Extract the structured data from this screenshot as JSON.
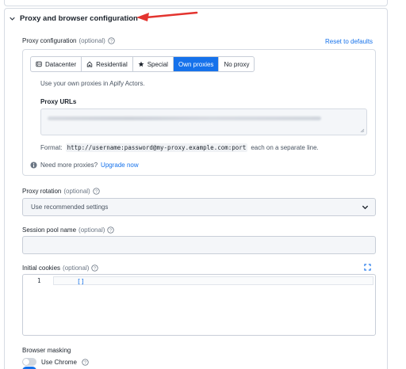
{
  "section": {
    "title": "Proxy and browser configuration"
  },
  "proxy_config": {
    "label": "Proxy configuration",
    "optional": "(optional)",
    "reset_label": "Reset to defaults",
    "tabs": [
      {
        "label": "Datacenter",
        "icon": "datacenter-icon",
        "active": false
      },
      {
        "label": "Residential",
        "icon": "home-icon",
        "active": false
      },
      {
        "label": "Special",
        "icon": "star-icon",
        "active": false
      },
      {
        "label": "Own proxies",
        "icon": "",
        "active": true
      },
      {
        "label": "No proxy",
        "icon": "",
        "active": false
      }
    ],
    "description": "Use your own proxies in Apify Actors.",
    "urls_label": "Proxy URLs",
    "format_prefix": "Format:",
    "format_code": "http://username:password@my-proxy.example.com:port",
    "format_suffix": "each on a separate line.",
    "need_more": "Need more proxies?",
    "upgrade_link": "Upgrade now"
  },
  "proxy_rotation": {
    "label": "Proxy rotation",
    "optional": "(optional)",
    "selected": "Use recommended settings"
  },
  "session_pool": {
    "label": "Session pool name",
    "optional": "(optional)",
    "value": ""
  },
  "initial_cookies": {
    "label": "Initial cookies",
    "optional": "(optional)",
    "line_number": "1",
    "code": "[]"
  },
  "browser_masking": {
    "label": "Browser masking",
    "use_chrome": "Use Chrome"
  },
  "colors": {
    "accent": "#1672eb",
    "arrow": "#e3342f"
  }
}
